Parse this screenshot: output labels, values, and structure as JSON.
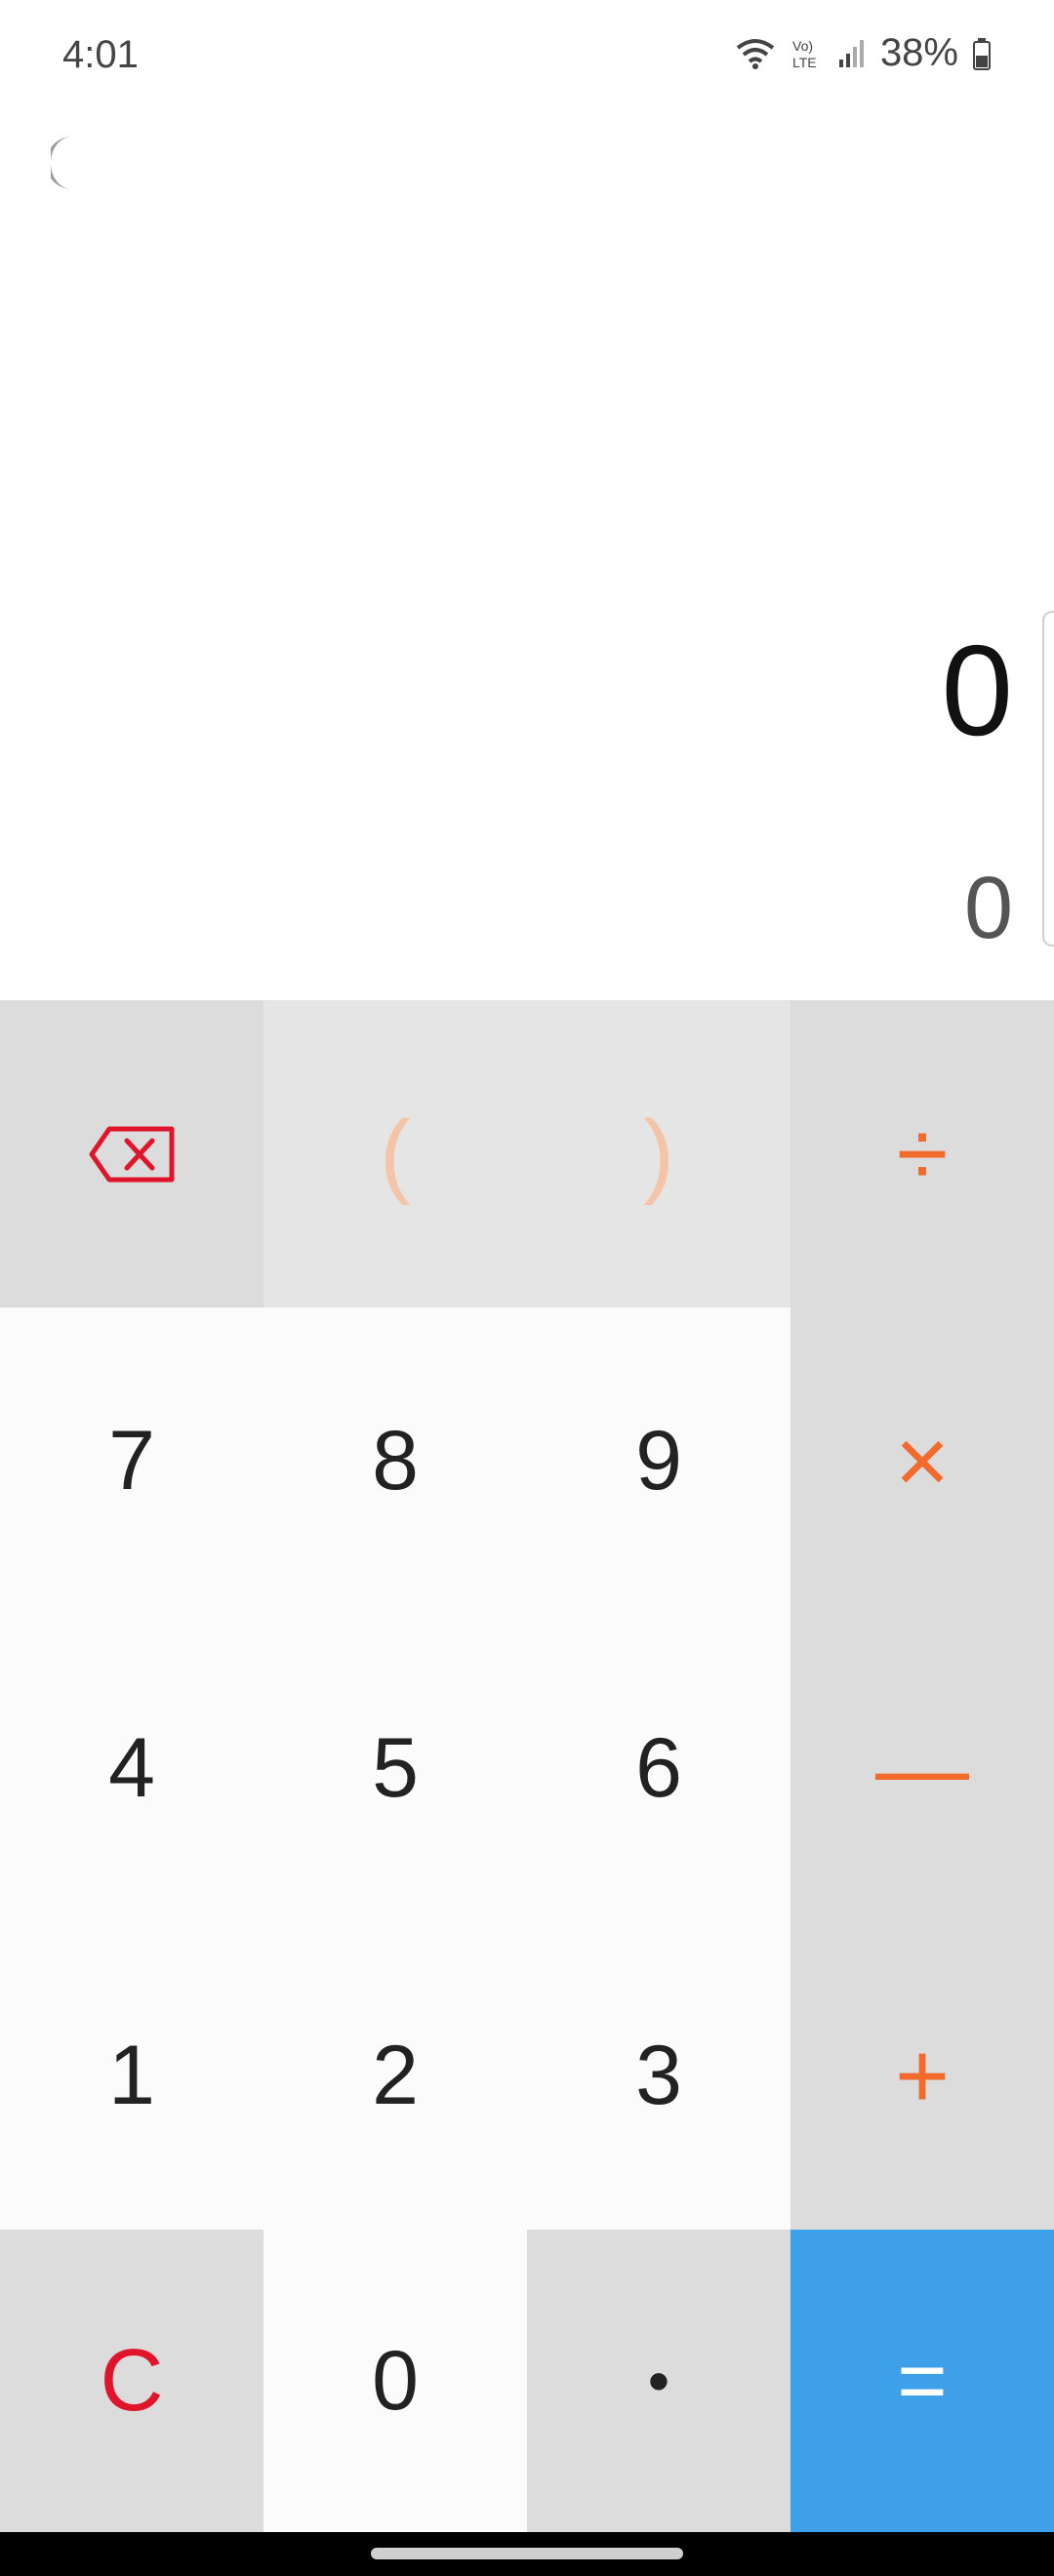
{
  "status_bar": {
    "time": "4:01",
    "battery_percent": "38%",
    "icons": [
      "wifi-icon",
      "volte-icon",
      "signal-icon",
      "battery-icon"
    ]
  },
  "display": {
    "expression": "0",
    "result": "0"
  },
  "keys": {
    "backspace_icon": "backspace-icon",
    "open_paren": "(",
    "close_paren": ")",
    "divide": "÷",
    "multiply": "×",
    "minus": "—",
    "plus": "+",
    "equals": "=",
    "clear": "C",
    "dot": "•",
    "digits": {
      "d0": "0",
      "d1": "1",
      "d2": "2",
      "d3": "3",
      "d4": "4",
      "d5": "5",
      "d6": "6",
      "d7": "7",
      "d8": "8",
      "d9": "9"
    }
  },
  "colors": {
    "operator": "#f26b2d",
    "clear": "#e0142b",
    "equals_bg": "#3fa0ea",
    "function_bg": "#dcdcdc"
  }
}
